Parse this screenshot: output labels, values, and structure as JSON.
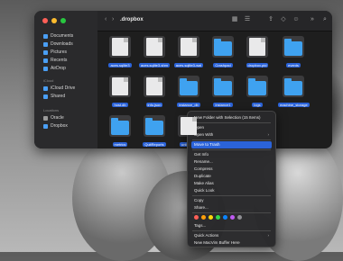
{
  "window": {
    "title": ".dropbox",
    "nav_back": "‹",
    "nav_forward": "›"
  },
  "sidebar": {
    "items": [
      {
        "label": "Documents",
        "icon": "doc-icon"
      },
      {
        "label": "Downloads",
        "icon": "download-icon"
      },
      {
        "label": "Pictures",
        "icon": "photo-icon"
      },
      {
        "label": "Recents",
        "icon": "clock-icon"
      },
      {
        "label": "AirDrop",
        "icon": "airdrop-icon"
      }
    ],
    "icloud_header": "iCloud",
    "icloud_items": [
      {
        "label": "iCloud Drive",
        "icon": "cloud-icon"
      },
      {
        "label": "Shared",
        "icon": "shared-folder-icon"
      }
    ],
    "locations_header": "Locations",
    "location_items": [
      {
        "label": "Oracle",
        "icon": "disk-icon"
      },
      {
        "label": "Dropbox",
        "icon": "dropbox-icon"
      }
    ]
  },
  "files": [
    {
      "name": "aces.sqlite3",
      "kind": "doc"
    },
    {
      "name": "aces.sqlite3-shm",
      "kind": "doc"
    },
    {
      "name": "aces.sqlite3-wal",
      "kind": "doc"
    },
    {
      "name": "Crashpad",
      "kind": "folder"
    },
    {
      "name": "dropbox.pid",
      "kind": "doc"
    },
    {
      "name": "events",
      "kind": "folder"
    },
    {
      "name": "host.db",
      "kind": "doc"
    },
    {
      "name": "info.json",
      "kind": "doc"
    },
    {
      "name": "instance_db",
      "kind": "folder"
    },
    {
      "name": "instance1",
      "kind": "folder"
    },
    {
      "name": "logs",
      "kind": "folder"
    },
    {
      "name": "machine_storage",
      "kind": "folder"
    },
    {
      "name": "metrics",
      "kind": "folder"
    },
    {
      "name": "QuitReports",
      "kind": "folder"
    },
    {
      "name": "unlink.db",
      "kind": "doc"
    }
  ],
  "context_menu": {
    "items": [
      {
        "label": "New Folder with Selection (15 Items)"
      },
      {
        "label": "Open"
      },
      {
        "label": "Open With",
        "submenu": true
      },
      {
        "label": "Move to Trash",
        "highlighted": true
      },
      {
        "label": "Get Info"
      },
      {
        "label": "Rename..."
      },
      {
        "label": "Compress"
      },
      {
        "label": "Duplicate"
      },
      {
        "label": "Make Alias"
      },
      {
        "label": "Quick Look"
      },
      {
        "label": "Copy"
      },
      {
        "label": "Share..."
      },
      {
        "label": "Tags..."
      },
      {
        "label": "Quick Actions",
        "submenu": true
      },
      {
        "label": "New MacVim Buffer Here"
      }
    ],
    "submenu_arrow": "›",
    "tag_colors": [
      "#ff5f57",
      "#ff9f0a",
      "#ffd60a",
      "#32d74b",
      "#0a84ff",
      "#bf5af2",
      "#8e8e93"
    ]
  },
  "colors": {
    "accent": "#2b63d9",
    "folder": "#3fa2f0"
  }
}
